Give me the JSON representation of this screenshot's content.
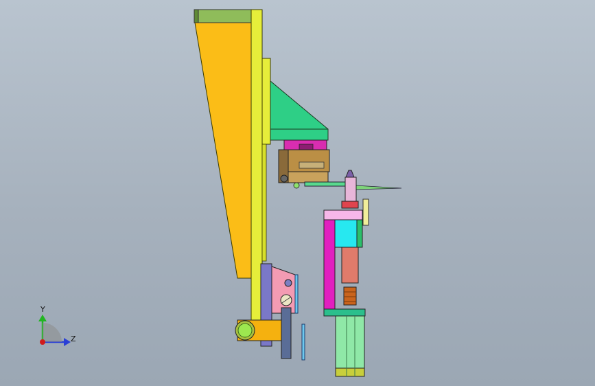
{
  "viewport": {
    "background_top": "#b9c4cf",
    "background_bottom": "#9ba7b4"
  },
  "model": {
    "colors": {
      "yellow_plate": "#e6ee3a",
      "orange_gusset": "#fbbd17",
      "olive_cap": "#8fbc5a",
      "green_bracket": "#2ecf86",
      "magenta": "#e11fbf",
      "cyan": "#27e8f0",
      "pink": "#f4a6e8",
      "salmon": "#e07b6b",
      "brown_block": "#bb8f45",
      "light_green": "#7fe39a",
      "lavender": "#7a78c8",
      "pink_bracket": "#f39bb3",
      "copper": "#c9641d",
      "slate": "#5a6d97"
    }
  },
  "triad": {
    "y_label": "Y",
    "z_label": "Z",
    "y_color": "#22b522",
    "z_color": "#2a3fd6",
    "x_color": "#d11b1b"
  }
}
